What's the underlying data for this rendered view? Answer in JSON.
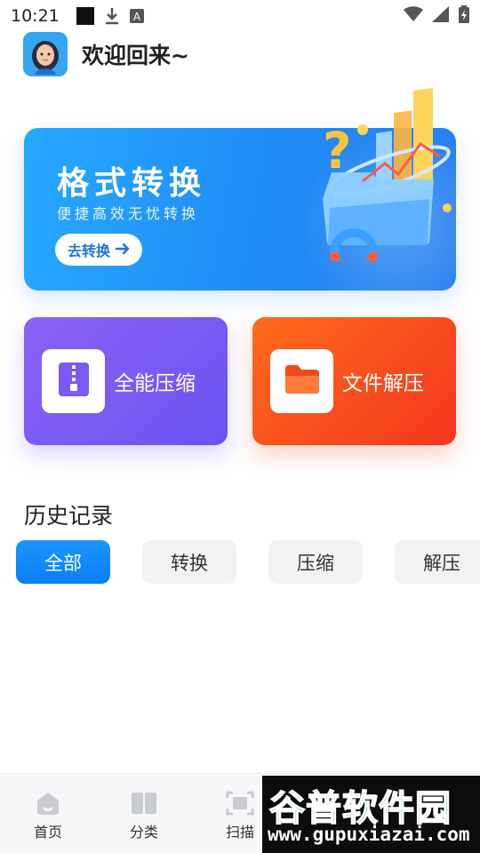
{
  "status_bar": {
    "time": "10:21",
    "left_icons": [
      "square-notification-icon",
      "download-icon",
      "a-notification-icon"
    ],
    "right_icons": [
      "wifi-icon",
      "signal-icon",
      "battery-charging-icon"
    ]
  },
  "header": {
    "welcome": "欢迎回来~"
  },
  "banner": {
    "title": "格式转换",
    "subtitle": "便捷高效无忧转换",
    "button_label": "去转换"
  },
  "features": {
    "compress_label": "全能压缩",
    "extract_label": "文件解压"
  },
  "history": {
    "title": "历史记录",
    "tabs": [
      {
        "label": "全部",
        "active": true
      },
      {
        "label": "转换",
        "active": false
      },
      {
        "label": "压缩",
        "active": false
      },
      {
        "label": "解压",
        "active": false
      }
    ]
  },
  "bottom_nav": {
    "items": [
      {
        "label": "首页",
        "icon": "home-icon"
      },
      {
        "label": "分类",
        "icon": "book-icon"
      },
      {
        "label": "扫描",
        "icon": "scan-icon"
      }
    ]
  },
  "watermark": {
    "title": "谷普软件园",
    "url": "www.gupuxiazai.com"
  },
  "colors": {
    "accent_blue": "#1a8cf5",
    "compress_purple": "#7b5af4",
    "extract_orange": "#f5471e"
  }
}
